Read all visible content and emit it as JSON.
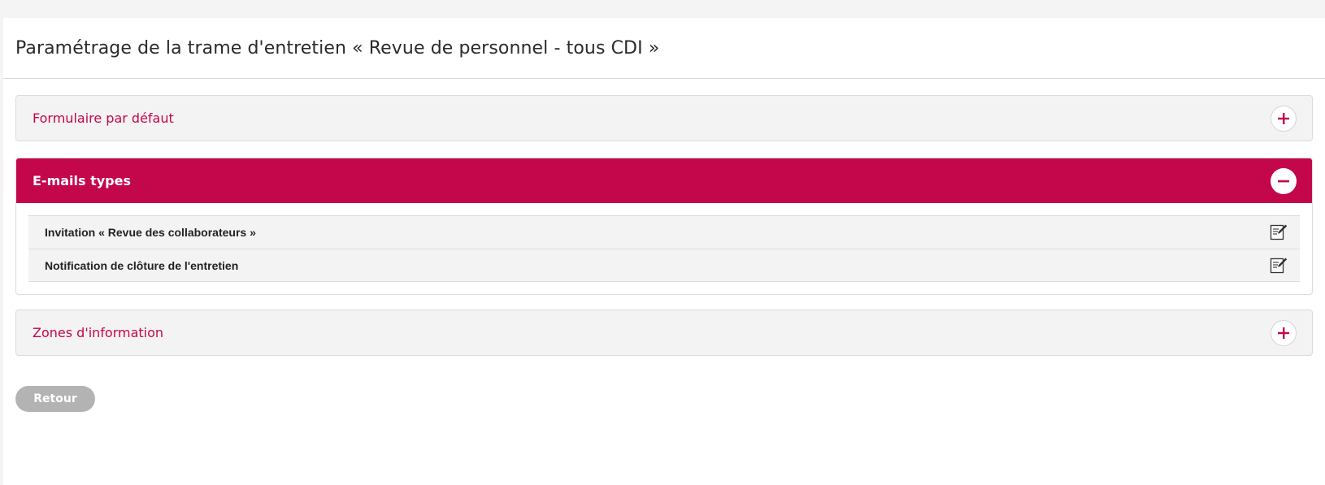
{
  "page": {
    "title": "Paramétrage de la trame d'entretien « Revue de personnel - tous CDI »"
  },
  "sections": {
    "default_form": {
      "title": "Formulaire par défaut",
      "state": "collapsed",
      "toggle_icon": "plus-icon"
    },
    "email_templates": {
      "title": "E-mails types",
      "state": "expanded",
      "toggle_icon": "minus-icon",
      "items": [
        {
          "label": "Invitation « Revue des collaborateurs »",
          "action_icon": "edit-icon"
        },
        {
          "label": "Notification de clôture de l'entretien",
          "action_icon": "edit-icon"
        }
      ]
    },
    "info_zones": {
      "title": "Zones d'information",
      "state": "collapsed",
      "toggle_icon": "plus-icon"
    }
  },
  "footer": {
    "back_label": "Retour"
  },
  "colors": {
    "accent": "#c4064b",
    "panel_bg": "#f3f3f3",
    "button_disabled": "#b3b3b3"
  }
}
